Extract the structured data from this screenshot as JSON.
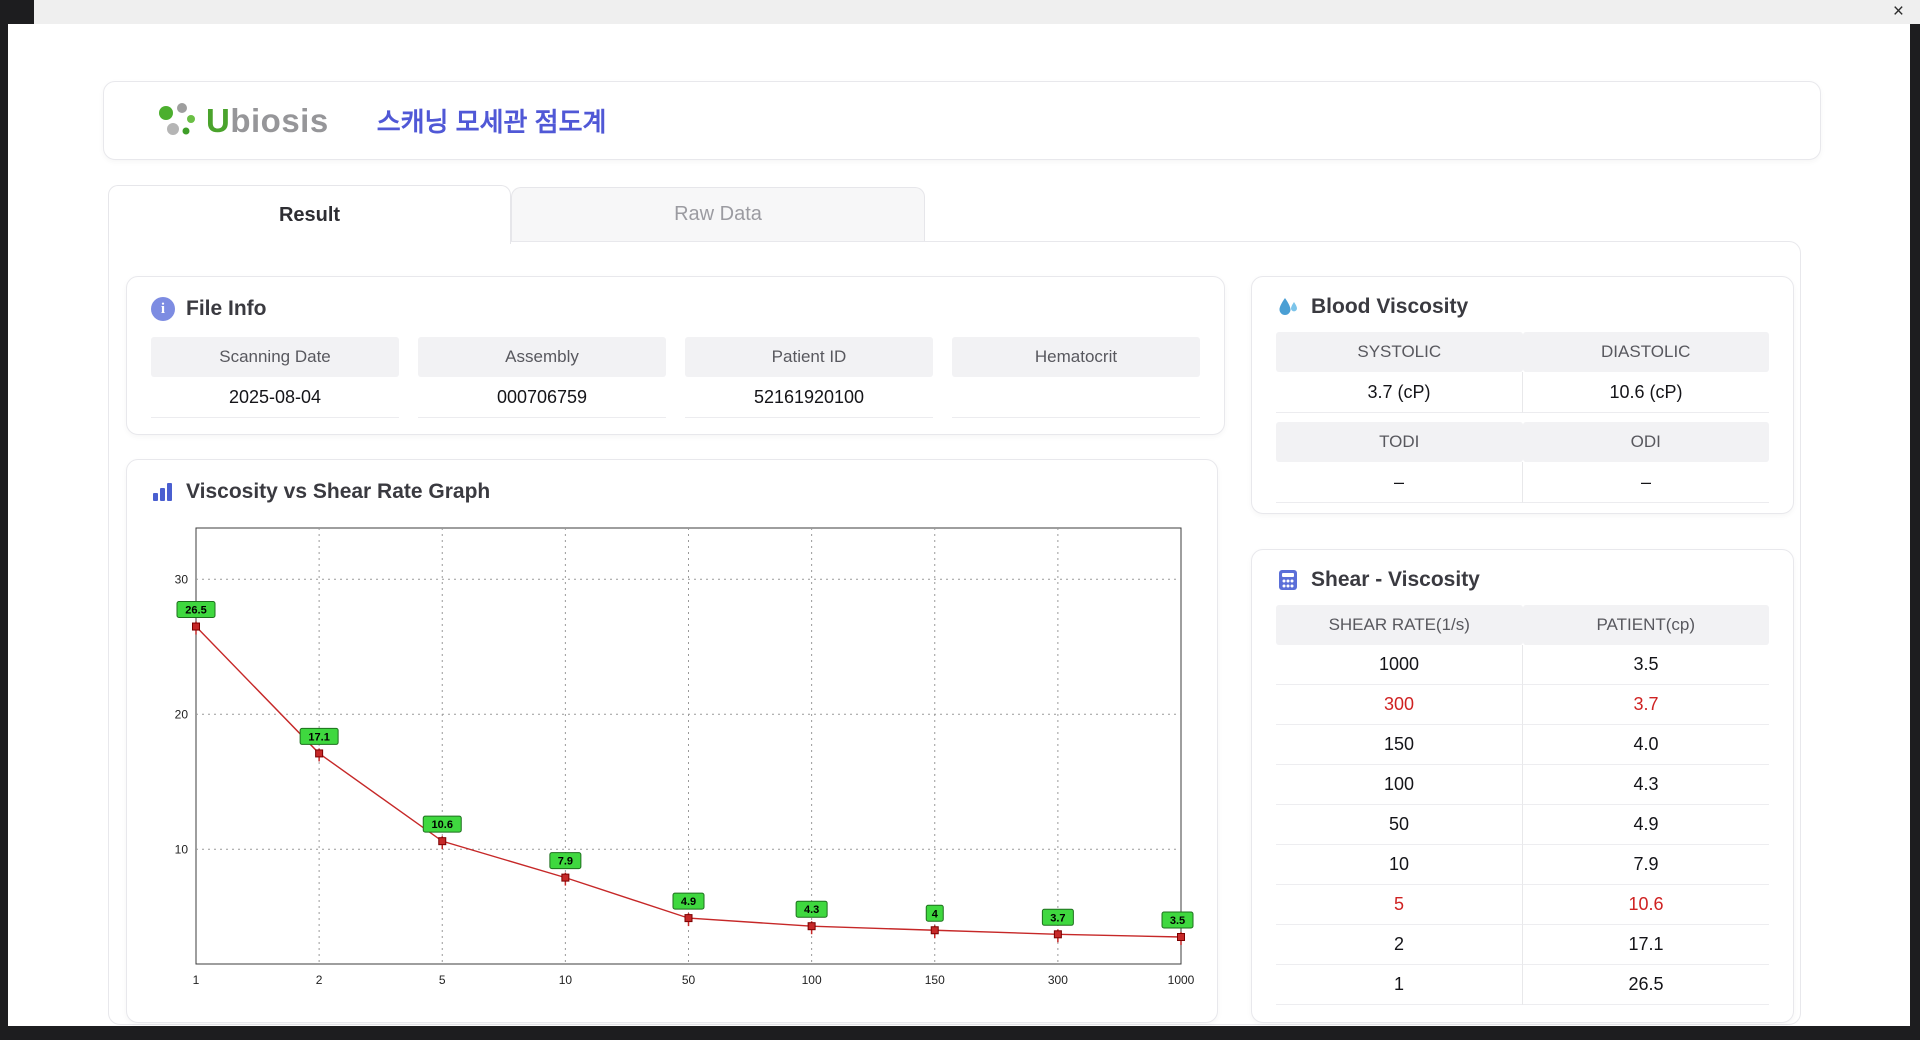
{
  "window": {
    "close_label": "×"
  },
  "header": {
    "logo_text_u": "U",
    "logo_text_rest": "biosis",
    "title": "스캐닝 모세관 점도계"
  },
  "tabs": [
    {
      "label": "Result",
      "active": true
    },
    {
      "label": "Raw Data",
      "active": false
    }
  ],
  "file_info": {
    "title": "File Info",
    "fields": [
      {
        "label": "Scanning Date",
        "value": "2025-08-04"
      },
      {
        "label": "Assembly",
        "value": "000706759"
      },
      {
        "label": "Patient ID",
        "value": "52161920100"
      },
      {
        "label": "Hematocrit",
        "value": ""
      }
    ]
  },
  "blood_viscosity": {
    "title": "Blood Viscosity",
    "cells": [
      {
        "label": "SYSTOLIC",
        "value": "3.7 (cP)"
      },
      {
        "label": "DIASTOLIC",
        "value": "10.6 (cP)"
      },
      {
        "label": "TODI",
        "value": "–"
      },
      {
        "label": "ODI",
        "value": "–"
      }
    ]
  },
  "graph": {
    "title": "Viscosity vs Shear Rate Graph"
  },
  "chart_data": {
    "type": "line",
    "title": "Viscosity vs Shear Rate Graph",
    "x_labels": [
      "1",
      "2",
      "5",
      "10",
      "50",
      "100",
      "150",
      "300",
      "1000"
    ],
    "values": [
      26.5,
      17.1,
      10.6,
      7.9,
      4.9,
      4.3,
      4,
      3.7,
      3.5
    ],
    "point_labels": [
      "26.5",
      "17.1",
      "10.6",
      "7.9",
      "4.9",
      "4.3",
      "4",
      "3.7",
      "3.5"
    ],
    "yticks": [
      10,
      20,
      30
    ],
    "ylim": [
      1.5,
      33.8
    ],
    "grid": true,
    "line_color": "#c62828",
    "marker_color": "#c62828",
    "marker_edge": "#7a0000",
    "label_bg": "#3fd83f",
    "label_edge": "#1d6f1d"
  },
  "shear_table": {
    "title": "Shear - Viscosity",
    "columns": [
      "SHEAR RATE(1/s)",
      "PATIENT(cp)"
    ],
    "highlight_color": "#cf2222",
    "rows": [
      {
        "shear": "1000",
        "patient": "3.5",
        "highlight": false
      },
      {
        "shear": "300",
        "patient": "3.7",
        "highlight": true
      },
      {
        "shear": "150",
        "patient": "4.0",
        "highlight": false
      },
      {
        "shear": "100",
        "patient": "4.3",
        "highlight": false
      },
      {
        "shear": "50",
        "patient": "4.9",
        "highlight": false
      },
      {
        "shear": "10",
        "patient": "7.9",
        "highlight": false
      },
      {
        "shear": "5",
        "patient": "10.6",
        "highlight": true
      },
      {
        "shear": "2",
        "patient": "17.1",
        "highlight": false
      },
      {
        "shear": "1",
        "patient": "26.5",
        "highlight": false
      }
    ]
  }
}
